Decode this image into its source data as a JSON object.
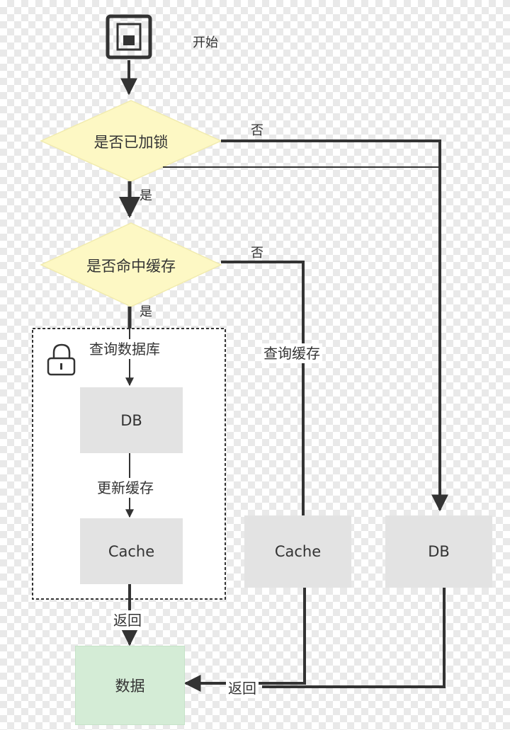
{
  "start": {
    "label": "开始"
  },
  "decisions": {
    "locked": {
      "label": "是否已加锁",
      "yes_label": "是",
      "no_label": "否"
    },
    "cache_hit": {
      "label": "是否命中缓存",
      "yes_label": "是",
      "no_label": "否"
    }
  },
  "lock_group": {
    "query_db_label": "查询数据库",
    "db_label": "DB",
    "update_cache_label": "更新缓存",
    "cache_label": "Cache",
    "return_label": "返回"
  },
  "middle_branch": {
    "query_cache_label": "查询缓存",
    "cache_label": "Cache"
  },
  "right_branch": {
    "db_label": "DB"
  },
  "result": {
    "data_label": "数据",
    "return_label": "返回"
  },
  "colors": {
    "diamond_fill": "#fdf8c4",
    "process_fill": "#e3e3e3",
    "data_fill": "#d4ecd6",
    "line": "#333333"
  }
}
